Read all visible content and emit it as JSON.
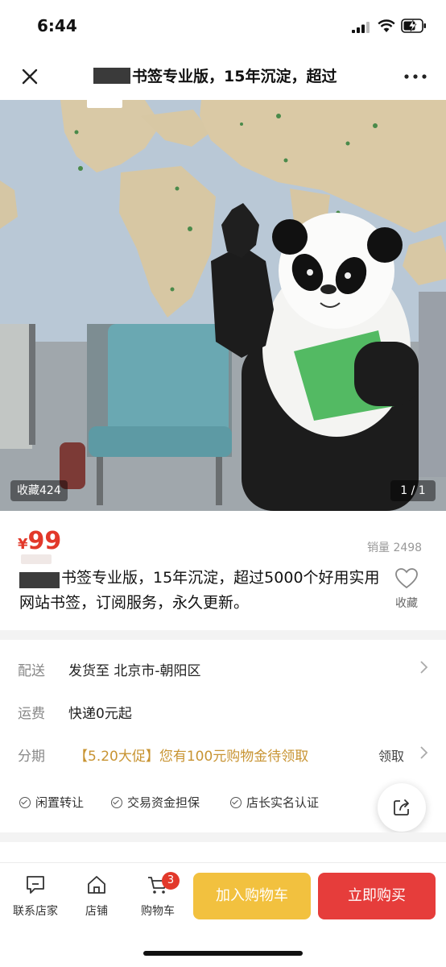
{
  "status_bar": {
    "time": "6:44"
  },
  "nav": {
    "title": "书签专业版，15年沉淀，超过"
  },
  "hero": {
    "favorites": "收藏424",
    "page_indicator": "1 / 1"
  },
  "product": {
    "currency": "¥",
    "price": "99",
    "sales": "销量 2498",
    "title": "书签专业版，15年沉淀，超过5000个好用实用网站书签，订阅服务，永久更新。",
    "favorite_label": "收藏"
  },
  "info": {
    "delivery_label": "配送",
    "delivery_value": "发货至  北京市-朝阳区",
    "shipping_label": "运费",
    "shipping_value": "快递0元起",
    "installment_label": "分期",
    "installment_value": "【5.20大促】您有100元购物金待领取",
    "claim_label": "领取",
    "guarantees": [
      "闲置转让",
      "交易资金担保",
      "店长实名认证"
    ]
  },
  "bottom_bar": {
    "contact": "联系店家",
    "shop": "店铺",
    "cart": "购物车",
    "cart_count": "3",
    "add_to_cart": "加入购物车",
    "buy_now": "立即购买"
  },
  "colors": {
    "price": "#e2382a",
    "promo": "#c89433",
    "add_cart": "#f2c13f",
    "buy_now": "#e63d3b"
  }
}
